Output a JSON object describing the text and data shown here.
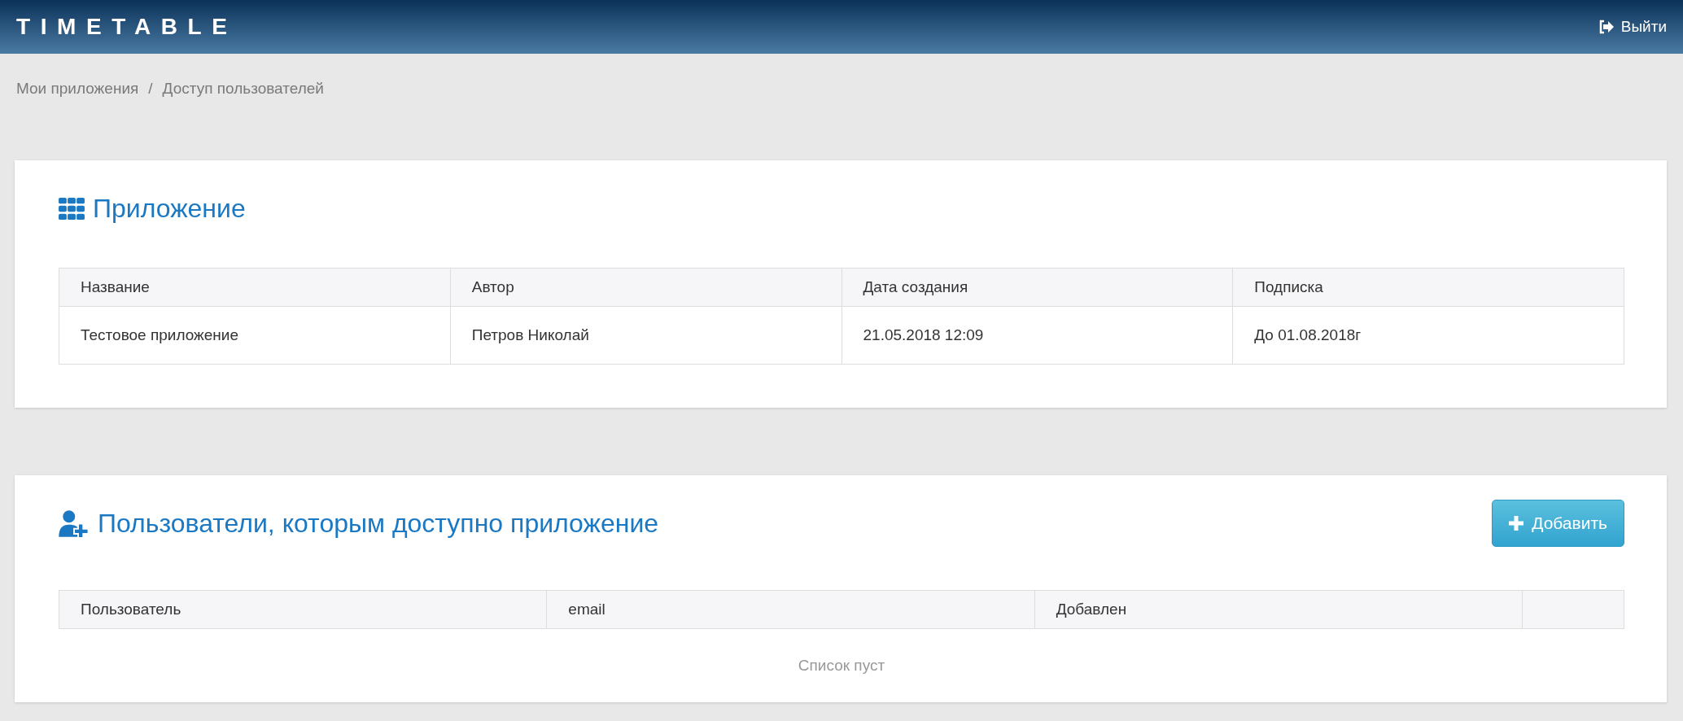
{
  "header": {
    "logo": "TIMETABLE",
    "logout": "Выйти"
  },
  "breadcrumb": {
    "items": [
      "Мои приложения",
      "Доступ пользователей"
    ],
    "separator": "/"
  },
  "app_panel": {
    "title": "Приложение",
    "columns": [
      "Название",
      "Автор",
      "Дата создания",
      "Подписка"
    ],
    "rows": [
      [
        "Тестовое приложение",
        "Петров Николай",
        "21.05.2018 12:09",
        "До 01.08.2018г"
      ]
    ]
  },
  "users_panel": {
    "title": "Пользователи, которым доступно приложение",
    "add_button": "Добавить",
    "columns": [
      "Пользователь",
      "email",
      "Добавлен",
      ""
    ],
    "empty_text": "Список пуст"
  }
}
